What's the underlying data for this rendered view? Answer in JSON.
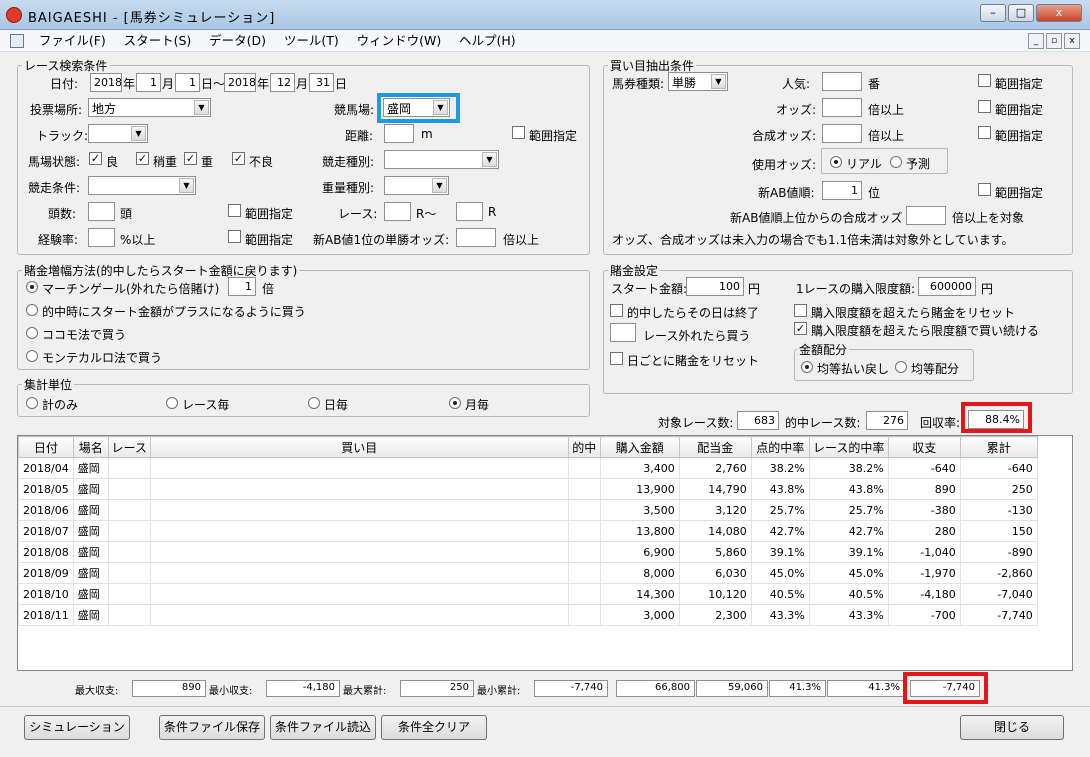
{
  "window": {
    "title": "BAIGAESHI - [馬券シミュレーション]",
    "minimize": "–",
    "maximize": "□",
    "close": "x"
  },
  "menu": [
    "ファイル(F)",
    "スタート(S)",
    "データ(D)",
    "ツール(T)",
    "ウィンドウ(W)",
    "ヘルプ(H)"
  ],
  "mdi": {
    "minimize": "_",
    "restore": "▫",
    "close": "x"
  },
  "race": {
    "legend": "レース検索条件",
    "date_label": "日付:",
    "year_from": "2018",
    "month_from": "1",
    "day_from": "1",
    "year_to": "2018",
    "month_to": "12",
    "day_to": "31",
    "nen": "年",
    "tsuki": "月",
    "hi_tilde": "日〜",
    "hi": "日",
    "venue_type_label": "投票場所:",
    "venue_type": "地方",
    "track_name_label": "競馬場:",
    "track_name": "盛岡",
    "track_label": "トラック:",
    "distance_label": "距離:",
    "distance_unit": "m",
    "range_label": "範囲指定",
    "condition_label": "馬場状態:",
    "cond1": "良",
    "cond2": "稍重",
    "cond3": "重",
    "cond4": "不良",
    "race_kind_label": "競走種別:",
    "race_cond_label": "競走条件:",
    "weight_kind_label": "重量種別:",
    "heads_label": "頭数:",
    "heads_unit": "頭",
    "race_label": "レース:",
    "race_from_unit": "R〜",
    "race_to_unit": "R",
    "exp_label": "経験率:",
    "exp_unit": "%以上",
    "ab_label": "新AB値1位の単勝オッズ:",
    "ab_unit": "倍以上"
  },
  "bet": {
    "legend": "買い目抽出条件",
    "type_label": "馬券種類:",
    "type": "単勝",
    "pop_label": "人気:",
    "pop_unit": "番",
    "odds_label": "オッズ:",
    "odds_unit": "倍以上",
    "comp_label": "合成オッズ:",
    "comp_unit": "倍以上",
    "range_label": "範囲指定",
    "use_odds_label": "使用オッズ:",
    "real": "リアル",
    "forecast": "予測",
    "ab_rank_label": "新AB値順:",
    "ab_rank": "1",
    "ab_rank_unit": "位",
    "ab_comp_pre": "新AB値順上位からの合成オッズ",
    "ab_comp_post": "倍以上を対象",
    "note": "オッズ、合成オッズは未入力の場合でも1.1倍未満は対象外としています。"
  },
  "money": {
    "legend": "賭金増幅方法(的中したらスタート金額に戻ります)",
    "m1": "マーチンゲール(外れたら倍賭け)",
    "m1_val": "1",
    "m1_unit": "倍",
    "m2": "的中時にスタート金額がプラスになるように買う",
    "m3": "ココモ法で買う",
    "m4": "モンテカルロ法で買う"
  },
  "unit": {
    "legend": "集計単位",
    "u1": "計のみ",
    "u2": "レース毎",
    "u3": "日毎",
    "u4": "月毎"
  },
  "setting": {
    "legend": "賭金設定",
    "start_label": "スタート金額:",
    "start": "100",
    "yen": "円",
    "limit_label": "1レースの購入限度額:",
    "limit": "600000",
    "end_on_hit": "的中したらその日は終了",
    "miss_buy": "レース外れたら買う",
    "reset_daily": "日ごとに賭金をリセット",
    "reset_over": "購入限度額を超えたら賭金をリセット",
    "keep_over": "購入限度額を超えたら限度額で買い続ける",
    "dist_legend": "金額配分",
    "dist1": "均等払い戻し",
    "dist2": "均等配分"
  },
  "stats": {
    "races_label": "対象レース数:",
    "races": "683",
    "hits_label": "的中レース数:",
    "hits": "276",
    "return_label": "回収率:",
    "return": "88.4%"
  },
  "table": {
    "headers": [
      "日付",
      "場名",
      "レース",
      "買い目",
      "的中",
      "購入金額",
      "配当金",
      "点的中率",
      "レース的中率",
      "収支",
      "累計"
    ],
    "rows": [
      [
        "2018/04",
        "盛岡",
        "",
        "",
        "",
        "3,400",
        "2,760",
        "38.2%",
        "38.2%",
        "-640",
        "-640"
      ],
      [
        "2018/05",
        "盛岡",
        "",
        "",
        "",
        "13,900",
        "14,790",
        "43.8%",
        "43.8%",
        "890",
        "250"
      ],
      [
        "2018/06",
        "盛岡",
        "",
        "",
        "",
        "3,500",
        "3,120",
        "25.7%",
        "25.7%",
        "-380",
        "-130"
      ],
      [
        "2018/07",
        "盛岡",
        "",
        "",
        "",
        "13,800",
        "14,080",
        "42.7%",
        "42.7%",
        "280",
        "150"
      ],
      [
        "2018/08",
        "盛岡",
        "",
        "",
        "",
        "6,900",
        "5,860",
        "39.1%",
        "39.1%",
        "-1,040",
        "-890"
      ],
      [
        "2018/09",
        "盛岡",
        "",
        "",
        "",
        "8,000",
        "6,030",
        "45.0%",
        "45.0%",
        "-1,970",
        "-2,860"
      ],
      [
        "2018/10",
        "盛岡",
        "",
        "",
        "",
        "14,300",
        "10,120",
        "40.5%",
        "40.5%",
        "-4,180",
        "-7,040"
      ],
      [
        "2018/11",
        "盛岡",
        "",
        "",
        "",
        "3,000",
        "2,300",
        "43.3%",
        "43.3%",
        "-700",
        "-7,740"
      ]
    ]
  },
  "summary": {
    "max_label": "最大収支:",
    "max": "890",
    "min_label": "最小収支:",
    "min": "-4,180",
    "maxc_label": "最大累計:",
    "maxc": "250",
    "minc_label": "最小累計:",
    "minc": "-7,740",
    "buy": "66,800",
    "pay": "59,060",
    "hit": "41.3%",
    "rhit": "41.3%",
    "total": "-7,740"
  },
  "buttons": {
    "sim": "シミュレーション",
    "save": "条件ファイル保存",
    "load": "条件ファイル読込",
    "clear": "条件全クリア",
    "close": "閉じる"
  },
  "colors": {
    "highlight_blue": "#1e9be0",
    "highlight_red": "#e3161c"
  }
}
